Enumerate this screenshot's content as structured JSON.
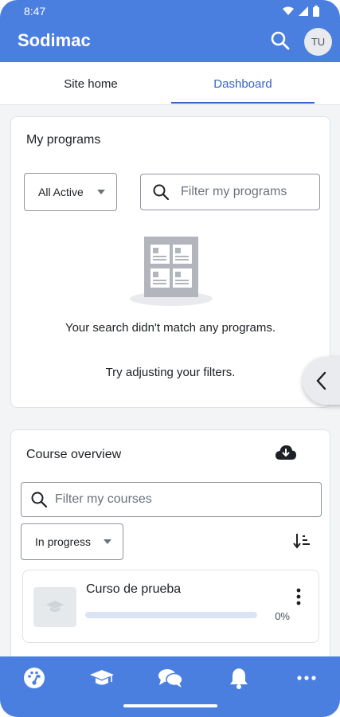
{
  "status_bar": {
    "time": "8:47"
  },
  "app": {
    "title": "Sodimac",
    "avatar_initials": "TU"
  },
  "tabs": [
    {
      "label": "Site home",
      "active": false
    },
    {
      "label": "Dashboard",
      "active": true
    }
  ],
  "my_programs": {
    "title": "My programs",
    "filter_select": "All Active",
    "search_placeholder": "Filter my programs",
    "empty_message": "Your search didn't match any programs.",
    "hint": "Try adjusting your filters."
  },
  "course_overview": {
    "title": "Course overview",
    "search_placeholder": "Filter my courses",
    "filter_select": "In progress",
    "courses": [
      {
        "name": "Curso de prueba",
        "progress_label": "0%",
        "progress": 0
      }
    ]
  },
  "bottom_nav": [
    "dashboard-icon",
    "courses-icon",
    "messages-icon",
    "notifications-icon",
    "more-icon"
  ],
  "colors": {
    "brand": "#4a7fe0",
    "accent": "#3565c5"
  }
}
